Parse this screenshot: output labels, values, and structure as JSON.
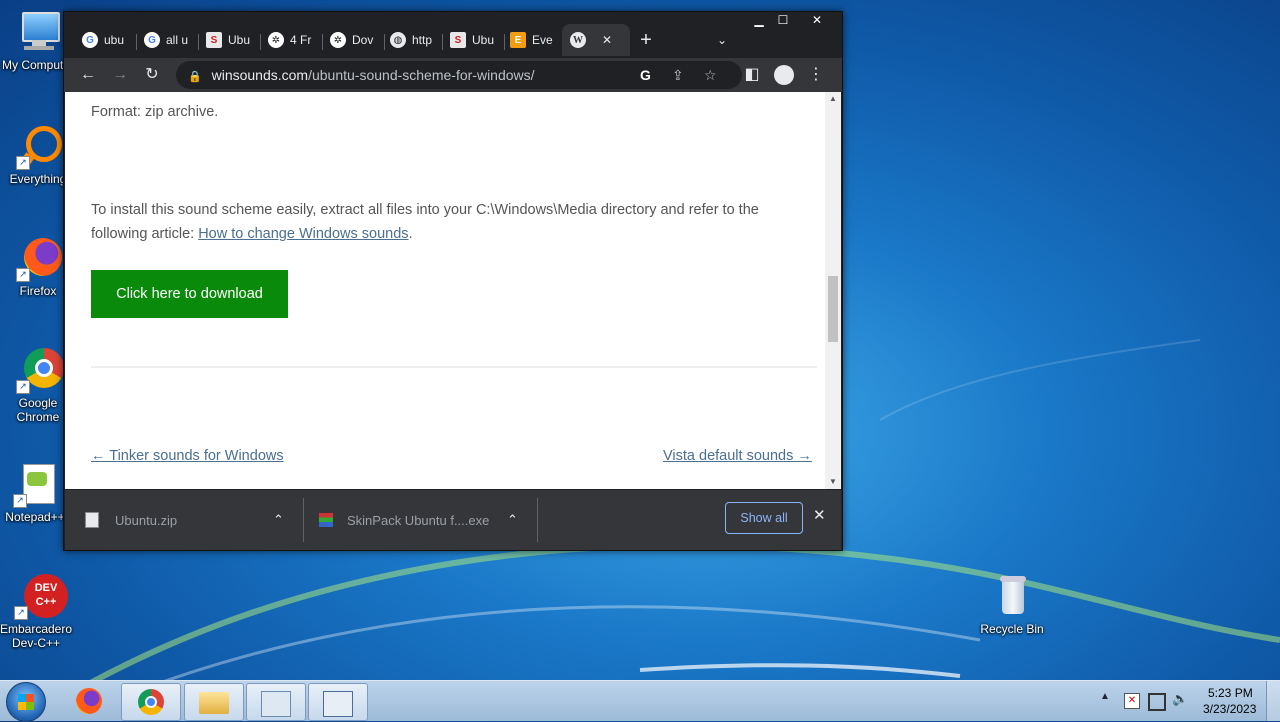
{
  "desktop": {
    "icons": [
      {
        "label": "My Computer"
      },
      {
        "label": "Everything"
      },
      {
        "label": "Firefox"
      },
      {
        "label": "Google Chrome"
      },
      {
        "label": "Notepad++"
      },
      {
        "label": "Embarcadero Dev-C++"
      },
      {
        "label": "Recycle Bin"
      }
    ]
  },
  "browser": {
    "tabs": [
      {
        "label": "ubu",
        "icon": "google-icon"
      },
      {
        "label": "all u",
        "icon": "google-icon"
      },
      {
        "label": "Ubu",
        "icon": "skinpack-icon"
      },
      {
        "label": "4 Fr",
        "icon": "site-icon"
      },
      {
        "label": "Dov",
        "icon": "site-icon"
      },
      {
        "label": "http",
        "icon": "globe-icon"
      },
      {
        "label": "Ubu",
        "icon": "skinpack-icon"
      },
      {
        "label": "Eve",
        "icon": "everything-icon"
      }
    ],
    "address": {
      "domain": "winsounds.com",
      "path": "/ubuntu-sound-scheme-for-windows/"
    }
  },
  "page": {
    "format_text": "Format: zip archive.",
    "install_text": "To install this sound scheme easily, extract all files into your C:\\Windows\\Media directory and refer to the",
    "install_text2": "following article: ",
    "install_link": "How to change Windows sounds",
    "install_end": ".",
    "download_button": "Click here to download",
    "prev_link": "← Tinker sounds for Windows",
    "next_link": "Vista default sounds →"
  },
  "downloads": {
    "items": [
      {
        "name": "Ubuntu.zip"
      },
      {
        "name": "SkinPack Ubuntu f....exe"
      }
    ],
    "show_all": "Show all"
  },
  "taskbar": {
    "time": "5:23 PM",
    "date": "3/23/2023"
  }
}
